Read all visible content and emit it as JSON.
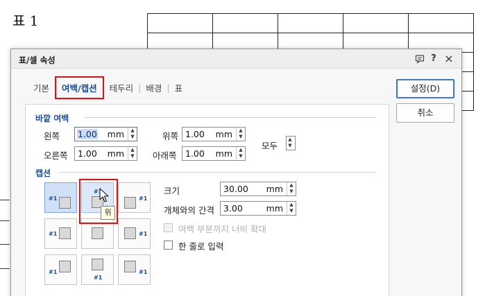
{
  "document": {
    "caption": "표 1"
  },
  "dialog": {
    "title": "표/셀 속성",
    "titlebar_icons": [
      "comment-icon",
      "help-icon",
      "close-icon"
    ],
    "help_label": "?",
    "close_label": "×",
    "tabs": [
      {
        "label": "기본",
        "active": false
      },
      {
        "label": "여백/캡션",
        "active": true
      },
      {
        "label": "테두리",
        "active": false
      },
      {
        "label": "배경",
        "active": false
      },
      {
        "label": "표",
        "active": false
      }
    ],
    "buttons": {
      "ok": "설정(D)",
      "cancel": "취소"
    },
    "outer_margin": {
      "heading": "바깥 여백",
      "left": {
        "label": "왼쪽",
        "value": "1.00",
        "unit": "mm"
      },
      "top": {
        "label": "위쪽",
        "value": "1.00",
        "unit": "mm"
      },
      "right": {
        "label": "오른쪽",
        "value": "1.00",
        "unit": "mm"
      },
      "bottom": {
        "label": "아래쪽",
        "value": "1.00",
        "unit": "mm"
      },
      "all": {
        "label": "모두"
      }
    },
    "caption": {
      "heading": "캡션",
      "position_tag": "#1",
      "positions": [
        {
          "name": "left-top",
          "selected": true
        },
        {
          "name": "top",
          "hover": true
        },
        {
          "name": "right-top"
        },
        {
          "name": "left"
        },
        {
          "name": "none"
        },
        {
          "name": "right"
        },
        {
          "name": "left-bottom"
        },
        {
          "name": "bottom"
        },
        {
          "name": "right-bottom"
        }
      ],
      "tooltip": "위",
      "size": {
        "label": "크기",
        "value": "30.00",
        "unit": "mm"
      },
      "gap": {
        "label": "개체와의 간격",
        "value": "3.00",
        "unit": "mm"
      },
      "extend_width": {
        "label": "여백 부분까지 너비 확대",
        "enabled": false,
        "checked": false
      },
      "single_line": {
        "label": "한 줄로 입력",
        "enabled": true,
        "checked": false
      }
    }
  },
  "colors": {
    "accent": "#1a4e9c",
    "highlight": "#e01010",
    "selection": "#cfe0f7"
  }
}
